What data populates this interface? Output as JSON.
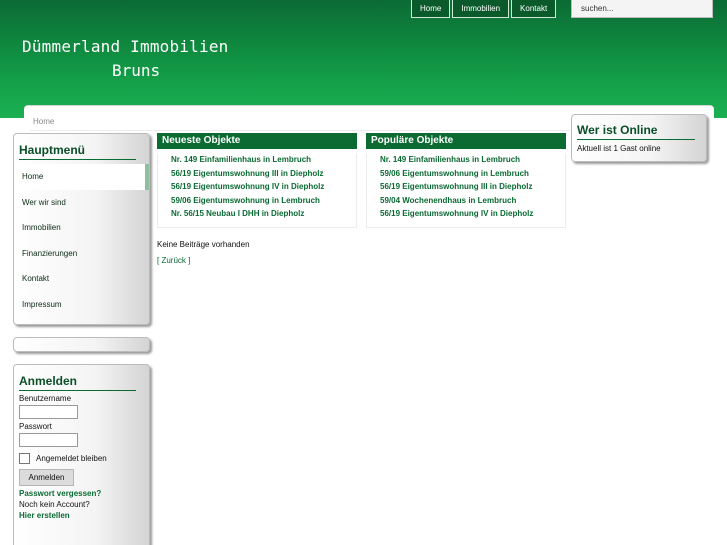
{
  "topnav": {
    "items": [
      "Home",
      "Immobilien",
      "Kontakt"
    ]
  },
  "search": {
    "placeholder": "suchen..."
  },
  "site": {
    "title_line1": "Dümmerland Immobilien",
    "title_line2": "Bruns"
  },
  "breadcrumb": "Home",
  "mainmenu": {
    "title": "Hauptmenü",
    "items": [
      "Home",
      "Wer wir sind",
      "Immobilien",
      "Finanzierungen",
      "Kontakt",
      "Impressum"
    ]
  },
  "login": {
    "title": "Anmelden",
    "username_label": "Benutzername",
    "password_label": "Passwort",
    "remember_label": "Angemeldet bleiben",
    "submit": "Anmelden",
    "forgot": "Passwort vergessen?",
    "no_account": "Noch kein Account?",
    "register": "Hier erstellen"
  },
  "latest": {
    "title": "Neueste Objekte",
    "items": [
      "Nr. 149 Einfamilienhaus in Lembruch",
      "56/19 Eigentumswohnung III in Diepholz",
      "56/19 Eigentumswohnung IV in Diepholz",
      "59/06 Eigentumswohnung in Lembruch",
      "Nr. 56/15 Neubau I DHH in Diepholz"
    ]
  },
  "popular": {
    "title": "Populäre Objekte",
    "items": [
      "Nr. 149 Einfamilienhaus in Lembruch",
      "59/06 Eigentumswohnung in Lembruch",
      "56/19 Eigentumswohnung III in Diepholz",
      "59/04 Wochenendhaus in Lembruch",
      "56/19 Eigentumswohnung IV in Diepholz"
    ]
  },
  "content": {
    "no_posts": "Keine Beiträge vorhanden",
    "back": "[ Zurück ]"
  },
  "online": {
    "title": "Wer ist Online",
    "text": "Aktuell ist 1 Gast online"
  }
}
